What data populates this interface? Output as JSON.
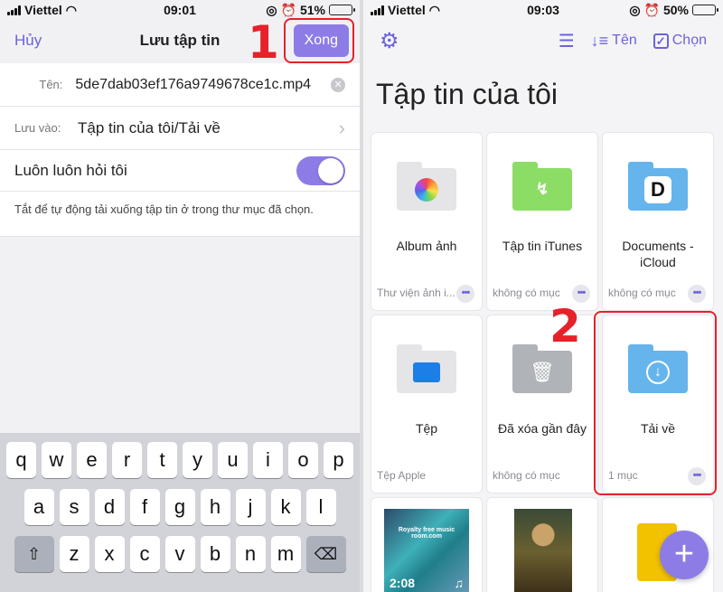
{
  "left": {
    "status": {
      "carrier": "Viettel",
      "time": "09:01",
      "battery": "51%"
    },
    "nav": {
      "cancel": "Hủy",
      "title": "Lưu tập tin",
      "done": "Xong"
    },
    "annotation": "1",
    "form": {
      "name_label": "Tên:",
      "name_value": "5de7dab03ef176a9749678ce1c.mp4",
      "save_label": "Lưu vào:",
      "save_value": "Tập tin của tôi/Tải về",
      "ask_label": "Luôn luôn hỏi tôi",
      "ask_on": true,
      "hint": "Tắt để tự động tải xuống tập tin ở trong thư mục đã chọn."
    },
    "keyboard": {
      "row1": [
        "q",
        "w",
        "e",
        "r",
        "t",
        "y",
        "u",
        "i",
        "o",
        "p"
      ],
      "row2": [
        "a",
        "s",
        "d",
        "f",
        "g",
        "h",
        "j",
        "k",
        "l"
      ],
      "row3": [
        "z",
        "x",
        "c",
        "v",
        "b",
        "n",
        "m"
      ]
    }
  },
  "right": {
    "status": {
      "carrier": "Viettel",
      "time": "09:03",
      "battery": "50%"
    },
    "toolbar": {
      "sort": "Tên",
      "select": "Chọn"
    },
    "title": "Tập tin của tôi",
    "annotation": "2",
    "items": [
      {
        "title": "Album ảnh",
        "sub": "Thư viện ảnh i..."
      },
      {
        "title": "Tập tin iTunes",
        "sub": "không có mục"
      },
      {
        "title": "Documents - iCloud",
        "sub": "không có mục"
      },
      {
        "title": "Tệp",
        "sub": "Tệp Apple"
      },
      {
        "title": "Đã xóa gần đây",
        "sub": "không có mục"
      },
      {
        "title": "Tải về",
        "sub": "1 mục"
      }
    ],
    "thumb": {
      "caption": "Royalty free music room.com",
      "duration": "2:08"
    },
    "fab": "+"
  }
}
